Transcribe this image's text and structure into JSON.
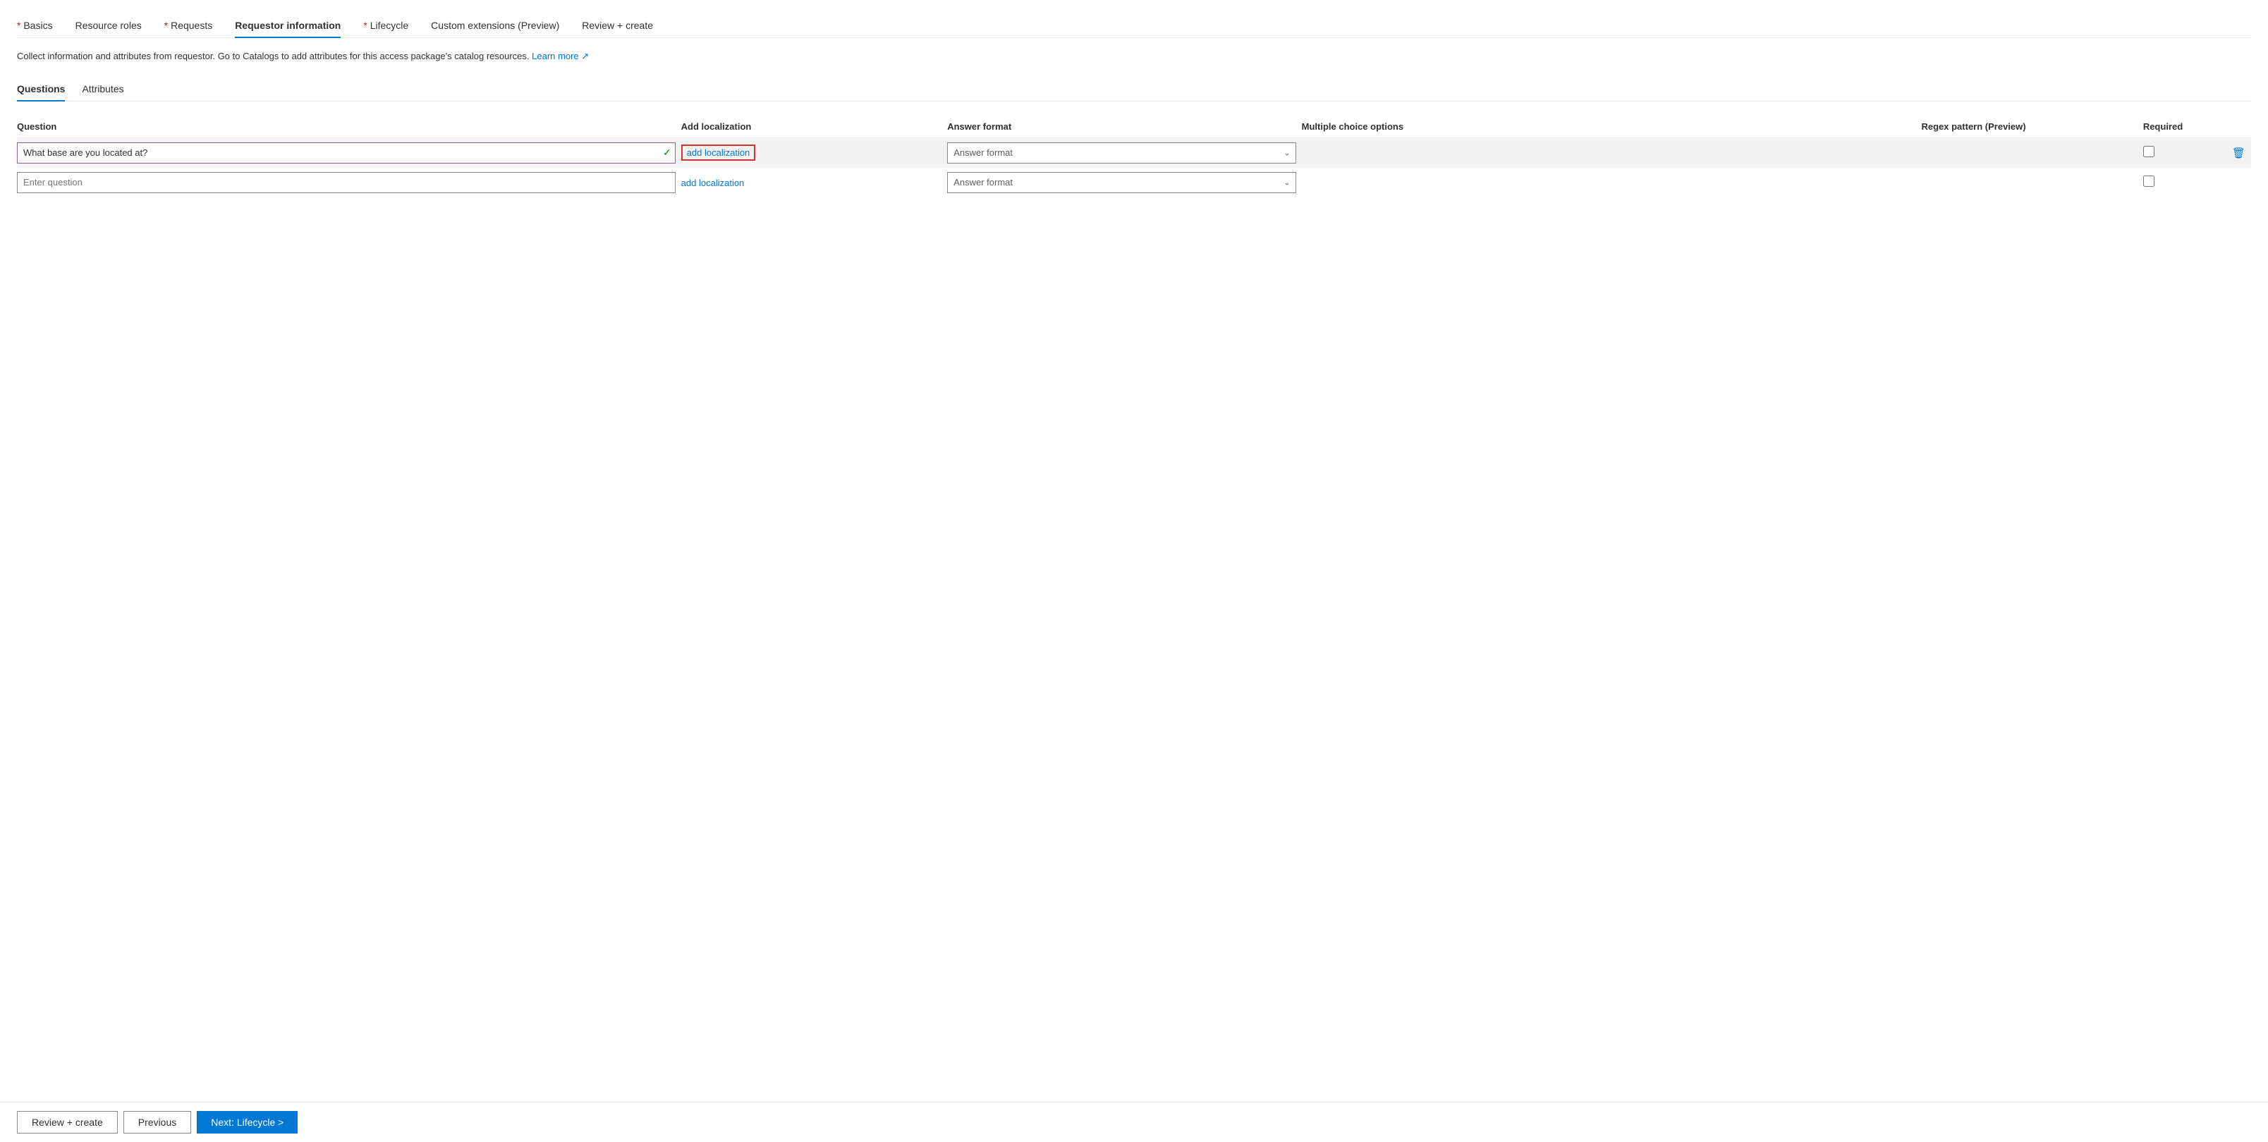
{
  "nav": {
    "tabs": [
      {
        "id": "basics",
        "label": "Basics",
        "required": true,
        "active": false
      },
      {
        "id": "resource-roles",
        "label": "Resource roles",
        "required": false,
        "active": false
      },
      {
        "id": "requests",
        "label": "Requests",
        "required": true,
        "active": false
      },
      {
        "id": "requestor-information",
        "label": "Requestor information",
        "required": false,
        "active": true
      },
      {
        "id": "lifecycle",
        "label": "Lifecycle",
        "required": true,
        "active": false
      },
      {
        "id": "custom-extensions",
        "label": "Custom extensions (Preview)",
        "required": false,
        "active": false
      },
      {
        "id": "review-create",
        "label": "Review + create",
        "required": false,
        "active": false
      }
    ]
  },
  "description": {
    "text": "Collect information and attributes from requestor. Go to Catalogs to add attributes for this access package's catalog resources.",
    "link_text": "Learn more",
    "link_icon": "↗"
  },
  "sub_tabs": [
    {
      "id": "questions",
      "label": "Questions",
      "active": true
    },
    {
      "id": "attributes",
      "label": "Attributes",
      "active": false
    }
  ],
  "table": {
    "columns": [
      {
        "id": "question",
        "label": "Question"
      },
      {
        "id": "add-localization",
        "label": "Add localization"
      },
      {
        "id": "answer-format",
        "label": "Answer format"
      },
      {
        "id": "multiple-choice",
        "label": "Multiple choice options"
      },
      {
        "id": "regex",
        "label": "Regex pattern (Preview)"
      },
      {
        "id": "required",
        "label": "Required"
      },
      {
        "id": "actions",
        "label": ""
      }
    ],
    "rows": [
      {
        "id": "row-1",
        "question_value": "What base are you located at?",
        "question_placeholder": "",
        "has_checkmark": true,
        "localization_text": "add localization",
        "localization_highlighted": true,
        "answer_format_placeholder": "Answer format",
        "multiple_choice": "",
        "regex": "",
        "required": false,
        "show_delete": true,
        "highlighted": true
      },
      {
        "id": "row-2",
        "question_value": "",
        "question_placeholder": "Enter question",
        "has_checkmark": false,
        "localization_text": "add localization",
        "localization_highlighted": false,
        "answer_format_placeholder": "Answer format",
        "multiple_choice": "",
        "regex": "",
        "required": false,
        "show_delete": false,
        "highlighted": false
      }
    ]
  },
  "footer": {
    "review_create_label": "Review + create",
    "previous_label": "Previous",
    "next_label": "Next: Lifecycle >"
  }
}
